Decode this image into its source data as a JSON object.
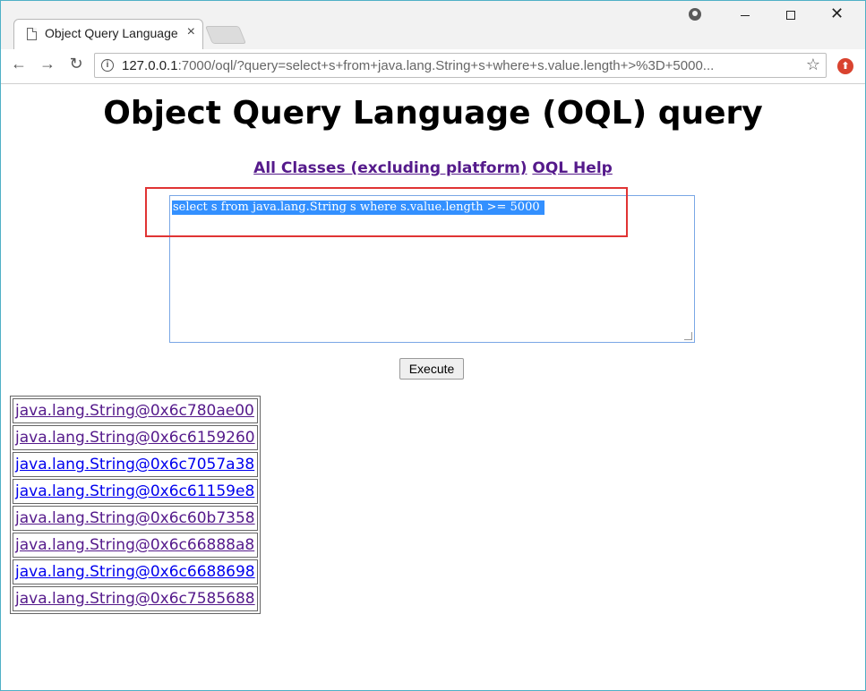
{
  "browser": {
    "tab_title": "Object Query Language",
    "tab_close": "×",
    "url_host": "127.0.0.1",
    "url_rest": ":7000/oql/?query=select+s+from+java.lang.String+s+where+s.value.length+>%3D+5000...",
    "nav_back": "←",
    "nav_forward": "→",
    "nav_reload": "↻",
    "bookmark_star": "☆",
    "window_close": "✕"
  },
  "page": {
    "title": "Object Query Language (OQL) query",
    "links": [
      {
        "label": "All Classes (excluding platform)"
      },
      {
        "label": "OQL Help"
      }
    ],
    "query_text": "select s from java.lang.String s where s.value.length >= 5000 ",
    "execute_label": "Execute",
    "results": [
      {
        "label": "java.lang.String@0x6c780ae00",
        "visited": true
      },
      {
        "label": "java.lang.String@0x6c6159260",
        "visited": true
      },
      {
        "label": "java.lang.String@0x6c7057a38",
        "visited": false
      },
      {
        "label": "java.lang.String@0x6c61159e8",
        "visited": false
      },
      {
        "label": "java.lang.String@0x6c60b7358",
        "visited": true
      },
      {
        "label": "java.lang.String@0x6c66888a8",
        "visited": true
      },
      {
        "label": "java.lang.String@0x6c6688698",
        "visited": false
      },
      {
        "label": "java.lang.String@0x6c7585688",
        "visited": true
      }
    ]
  },
  "colors": {
    "visited_link": "#551a8b",
    "unvisited_link": "#0000ee",
    "selection": "#3390ff",
    "annotation": "#e03434"
  }
}
